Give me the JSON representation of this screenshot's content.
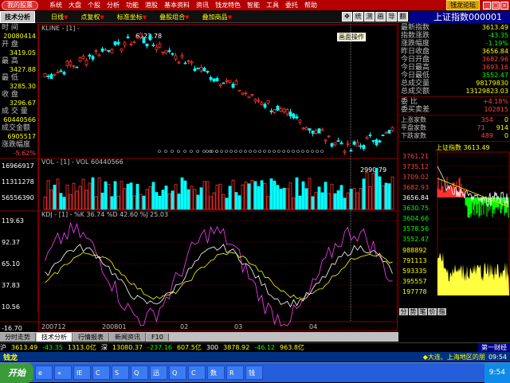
{
  "titlebar": {
    "app_tag": "我的股票",
    "menu": [
      "系统",
      "大盘",
      "个股",
      "分析",
      "功能",
      "港股",
      "基本资料",
      "资讯",
      "钱龙特色",
      "智能",
      "工具",
      "委托",
      "帮助"
    ],
    "forum": "钱龙论坛"
  },
  "toolbar": {
    "tab": "技术分析",
    "items": [
      {
        "label": "日线",
        "mark": "▼"
      },
      {
        "label": "点复权",
        "mark": "▼"
      },
      {
        "label": "标准坐标",
        "mark": "▼"
      },
      {
        "label": "叠股组合",
        "mark": "▼"
      },
      {
        "label": "叠加商品",
        "mark": "▼"
      }
    ],
    "tools": [
      "✥",
      "统",
      "测",
      "画",
      "导",
      "翻"
    ],
    "tooltip": "画面操作"
  },
  "leftcol": {
    "time_label": "时 间",
    "time_val": "20080414",
    "open_label": "开 盘",
    "open_val": "3419.05",
    "high_label": "最 高",
    "high_val": "3427.88",
    "low_label": "最 低",
    "low_val": "3285.30",
    "close_label": "收 盘",
    "close_val": "3296.67",
    "vol_label": "成 交 量",
    "vol_val": "60440566",
    "amount_label": "成交金额",
    "amount_val": "6905517",
    "chg_label": "涨跌幅度",
    "chg_val": "-5.62%",
    "vol_axis": [
      "16966917",
      "11311278",
      "56556390"
    ],
    "kdj_axis": [
      "119.63",
      "92.37",
      "65.10",
      "37.83",
      "10.56",
      "-16.70"
    ]
  },
  "chart": {
    "kline_title": "KLINE - [1] -",
    "high_tag": "6522.78",
    "low_tag": "2990.79",
    "vol_title": "VOL - [1] - VOL 60440566",
    "kdj_title": "KDJ - [1] - %K 36.74 %D 42.60 %J 25.03",
    "x_labels": [
      "200712",
      "200801",
      "02",
      "03",
      "04"
    ]
  },
  "rightpanel": {
    "title": "上证指数000001",
    "rows": [
      {
        "k": "最新指数",
        "v": "3613.49",
        "c": ""
      },
      {
        "k": "指数涨跌",
        "v": "-43.35",
        "c": "grn"
      },
      {
        "k": "涨跌幅度",
        "v": "-1.19%",
        "c": "grn"
      },
      {
        "k": "昨日收盘",
        "v": "3656.84",
        "c": ""
      },
      {
        "k": "今日开盘",
        "v": "3682.96",
        "c": "red"
      },
      {
        "k": "今日最高",
        "v": "3693.16",
        "c": "red"
      },
      {
        "k": "今日最低",
        "v": "3552.47",
        "c": "grn"
      },
      {
        "k": "总成交量",
        "v": "98179830",
        "c": ""
      },
      {
        "k": "总成交额",
        "v": "13129823.03",
        "c": ""
      }
    ],
    "rows2": [
      {
        "k": "委 比",
        "v": "+4.18%",
        "c": "red"
      },
      {
        "k": "委买卖差",
        "v": "102815",
        "c": "red"
      }
    ],
    "rows3": [
      {
        "k": "上涨家数",
        "a": "354",
        "b": "0"
      },
      {
        "k": "平盘家数",
        "a": "71",
        "b": "914"
      },
      {
        "k": "下跌家数",
        "a": "489",
        "b": "0"
      }
    ],
    "mini_title": "上证指数 3613.49",
    "mini_price_axis": [
      "3761.21",
      "3735.12",
      "3709.02",
      "3682.93",
      "3656.84",
      "3630.75",
      "3604.66",
      "3578.56",
      "3552.47"
    ],
    "mini_vol_axis": [
      "988892",
      "791113",
      "593335",
      "395557",
      "197778"
    ],
    "tabs": [
      "分",
      "势",
      "笔",
      "价",
      "指"
    ]
  },
  "bottomtabs": [
    "分时走势",
    "技术分析",
    "行情报表",
    "新闻资讯",
    "F10"
  ],
  "ticker": [
    {
      "t": "沪",
      "c": "w"
    },
    {
      "t": "3613.49",
      "c": "y"
    },
    {
      "t": "-43.35",
      "c": "g"
    },
    {
      "t": "1313.0亿",
      "c": "y"
    },
    {
      "t": "深",
      "c": "w"
    },
    {
      "t": "13080.37",
      "c": "y"
    },
    {
      "t": "-237.16",
      "c": "g"
    },
    {
      "t": "607.5亿",
      "c": "y"
    },
    {
      "t": "300",
      "c": "w"
    },
    {
      "t": "3878.92",
      "c": "y"
    },
    {
      "t": "-46.12",
      "c": "g"
    },
    {
      "t": "963.8亿",
      "c": "y"
    }
  ],
  "ticker_right": "第一财经",
  "status": {
    "left": "钱龙",
    "marquee": "◆大连、上海地区的朋",
    "time": "09:54"
  },
  "taskbar": {
    "start": "开始",
    "tasks": [
      "e",
      "«",
      "IE",
      "C",
      "S",
      "Q",
      "迅",
      "Q",
      "C",
      "数",
      "R",
      "钱"
    ],
    "clock": "9:54"
  }
}
